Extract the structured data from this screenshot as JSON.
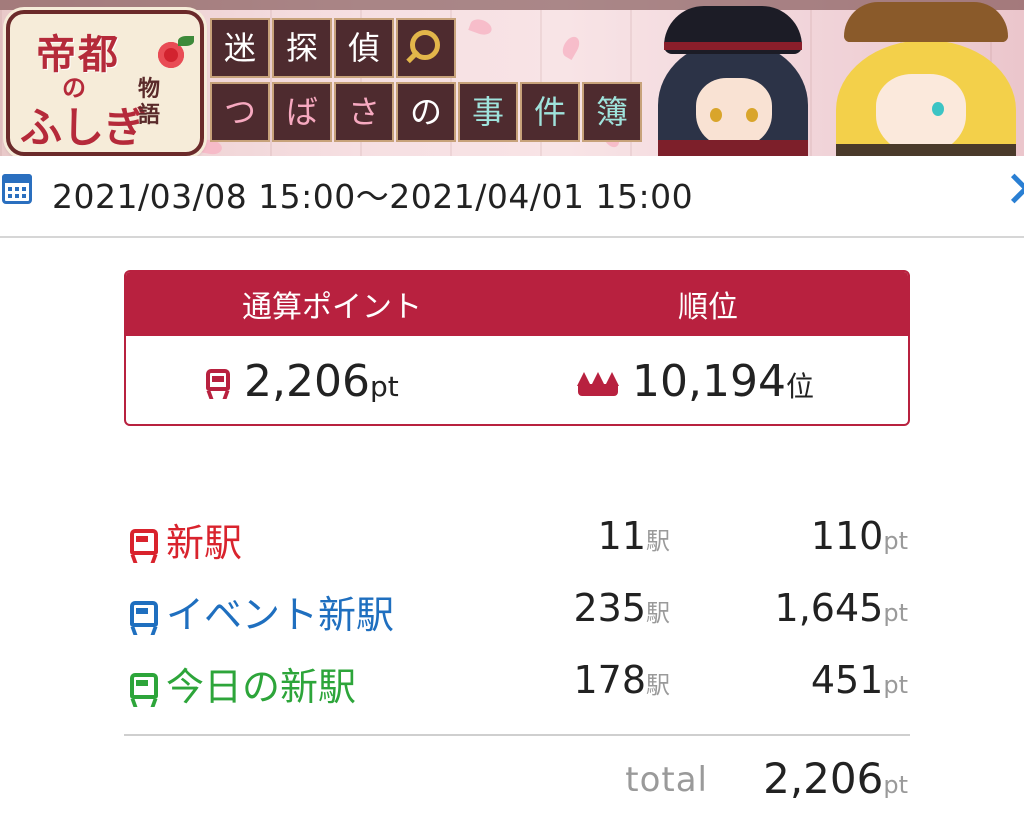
{
  "banner": {
    "logo_title": "帝都",
    "logo_no": "の",
    "logo_sub": "ふしぎ",
    "logo_mono": "物語",
    "title_row1": [
      "迷",
      "探",
      "偵"
    ],
    "title_row2": [
      "つ",
      "ば",
      "さ",
      "の",
      "事",
      "件",
      "簿"
    ]
  },
  "period": {
    "text": "2021/03/08 15:00～2021/04/01 15:00"
  },
  "summary": {
    "points_label": "通算ポイント",
    "rank_label": "順位",
    "points_value": "2,206",
    "points_unit": "pt",
    "rank_value": "10,194",
    "rank_unit": "位"
  },
  "breakdown": [
    {
      "name": "新駅",
      "count": "11",
      "count_unit": "駅",
      "points": "110",
      "points_unit": "pt",
      "color": "#d9232d"
    },
    {
      "name": "イベント新駅",
      "count": "235",
      "count_unit": "駅",
      "points": "1,645",
      "points_unit": "pt",
      "color": "#1f6fbf"
    },
    {
      "name": "今日の新駅",
      "count": "178",
      "count_unit": "駅",
      "points": "451",
      "points_unit": "pt",
      "color": "#2da53a"
    }
  ],
  "total": {
    "label": "total",
    "value": "2,206",
    "unit": "pt"
  },
  "colors": {
    "accent": "#b8213f",
    "link": "#2a7fd3"
  }
}
